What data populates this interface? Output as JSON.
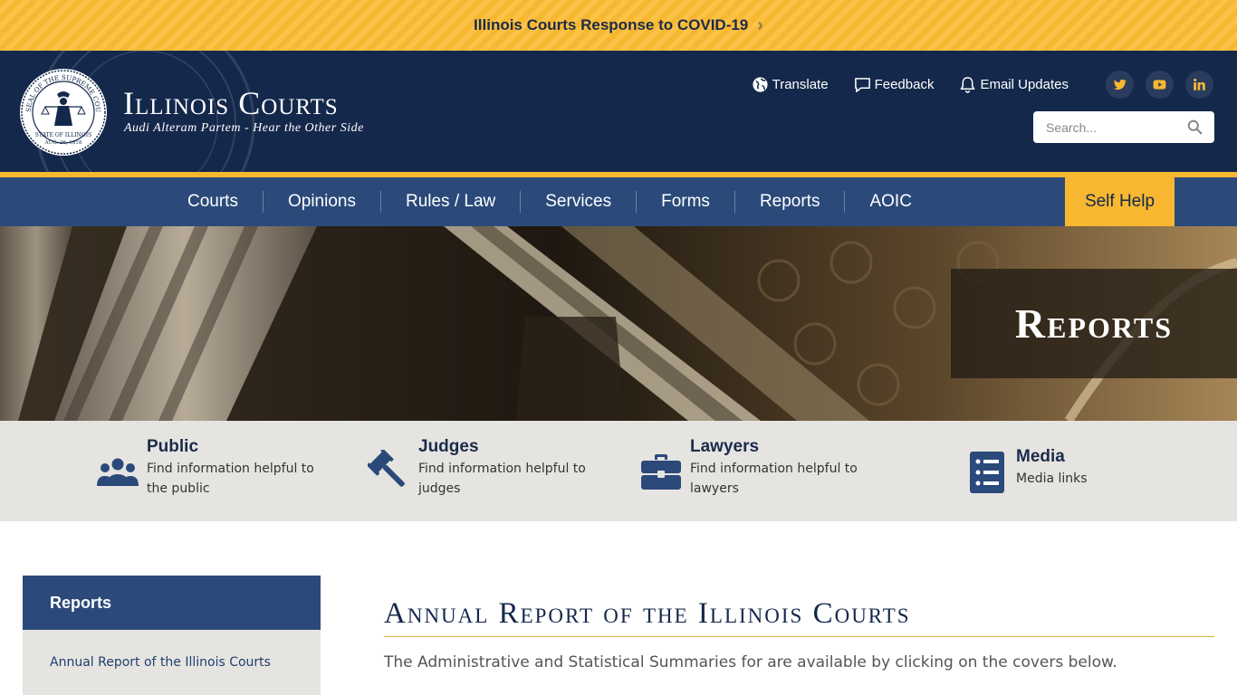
{
  "banner": {
    "text": "Illinois Courts Response to COVID-19",
    "chevron": "›"
  },
  "header": {
    "title": "Illinois Courts",
    "motto": "Audi Alteram Partem - Hear the Other Side",
    "seal_text_top": "SEAL OF THE SUPREME COURT",
    "seal_text_bottom": "STATE OF ILLINOIS",
    "seal_date": "AUG. 26, 1818",
    "utility_links": [
      {
        "label": "Translate",
        "icon": "globe-icon"
      },
      {
        "label": "Feedback",
        "icon": "speech-bubble-icon"
      },
      {
        "label": "Email Updates",
        "icon": "bell-icon"
      }
    ],
    "social": [
      "twitter-icon",
      "youtube-icon",
      "linkedin-icon"
    ],
    "search": {
      "placeholder": "Search..."
    }
  },
  "nav": {
    "items": [
      "Courts",
      "Opinions",
      "Rules / Law",
      "Services",
      "Forms",
      "Reports",
      "AOIC"
    ],
    "self_help": "Self Help"
  },
  "hero": {
    "title": "Reports"
  },
  "audience": [
    {
      "title": "Public",
      "desc": "Find information helpful to the public",
      "icon": "people-icon"
    },
    {
      "title": "Judges",
      "desc": "Find information helpful to judges",
      "icon": "gavel-icon"
    },
    {
      "title": "Lawyers",
      "desc": "Find information helpful to lawyers",
      "icon": "briefcase-icon"
    },
    {
      "title": "Media",
      "desc": "Media links",
      "icon": "list-document-icon"
    }
  ],
  "sidebar": {
    "heading": "Reports",
    "items": [
      "Annual Report of the Illinois Courts"
    ]
  },
  "content": {
    "title": "Annual Report of the Illinois Courts",
    "intro": "The Administrative and Statistical Summaries for are available by clicking on the covers below."
  },
  "colors": {
    "navy": "#14284b",
    "nav_blue": "#2b4a7a",
    "gold": "#f7b731",
    "strip_gray": "#e6e4e1"
  }
}
